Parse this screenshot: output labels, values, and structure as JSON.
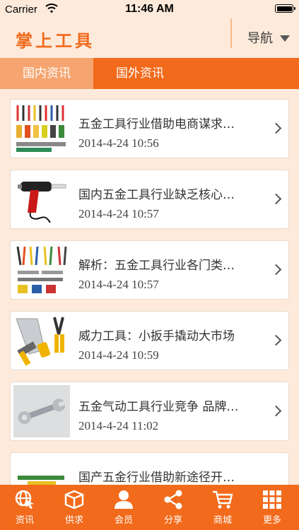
{
  "status_bar": {
    "carrier": "Carrier",
    "time": "11:46 AM"
  },
  "header": {
    "title": "掌上工具",
    "nav_label": "导航"
  },
  "tabs": [
    {
      "label": "国内资讯",
      "active": true
    },
    {
      "label": "国外资讯",
      "active": false
    }
  ],
  "news": [
    {
      "title": "五金工具行业借助电商谋求…",
      "time": "2014-4-24 10:56",
      "thumb": "tools-assortment-icon"
    },
    {
      "title": "国内五金工具行业缺乏核心…",
      "time": "2014-4-24 10:57",
      "thumb": "glue-gun-icon"
    },
    {
      "title": "解析：五金工具行业各门类…",
      "time": "2014-4-24 10:57",
      "thumb": "tool-set-icon"
    },
    {
      "title": "威力工具：小扳手撬动大市场",
      "time": "2014-4-24 10:59",
      "thumb": "saw-hammer-pliers-icon"
    },
    {
      "title": "五金气动工具行业竞争 品牌…",
      "time": "2014-4-24 11:02",
      "thumb": "wrench-icon"
    },
    {
      "title": "国产五金行业借助新途径开…",
      "time": "",
      "thumb": "tools-icon"
    }
  ],
  "tabbar": [
    {
      "label": "资讯",
      "icon": "globe-cursor-icon"
    },
    {
      "label": "供求",
      "icon": "box-icon"
    },
    {
      "label": "会员",
      "icon": "user-icon"
    },
    {
      "label": "分享",
      "icon": "share-icon"
    },
    {
      "label": "商城",
      "icon": "cart-icon"
    },
    {
      "label": "更多",
      "icon": "grid-icon"
    }
  ],
  "colors": {
    "accent": "#f26a1b",
    "tab_active": "#f6a570",
    "background": "#fdeadb"
  }
}
